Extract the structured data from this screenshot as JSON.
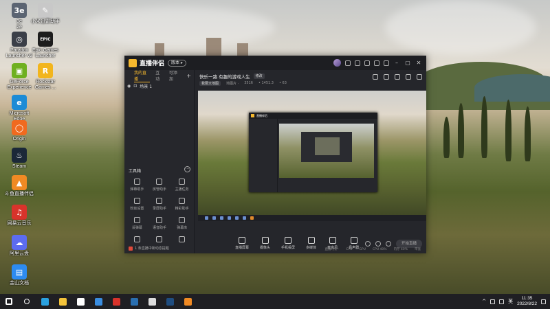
{
  "desktop": {
    "icons": [
      {
        "label": "3e\n2e",
        "color": "#5b6472",
        "glyph": "3e"
      },
      {
        "label": "小米迅雷助手",
        "color": "#c8c8c8",
        "glyph": "✎"
      },
      {
        "label": "Paradox\nLauncher v2",
        "color": "#3b3f48",
        "glyph": "◎"
      },
      {
        "label": "Epic Games\nLauncher",
        "color": "#1d1d1d",
        "glyph": "EPIC"
      },
      {
        "label": "GeForce\nExperience",
        "color": "#6fb020",
        "glyph": "▣"
      },
      {
        "label": "Rockstar\nGames ...",
        "color": "#f2b51d",
        "glyph": "R"
      },
      {
        "label": "Microsoft\nEdge",
        "color": "#1c8bd6",
        "glyph": "e"
      },
      {
        "label": "Origin",
        "color": "#f06a1f",
        "glyph": "◯"
      },
      {
        "label": "Steam",
        "color": "#1b2838",
        "glyph": "♨"
      },
      {
        "label": "斗鱼直播伴侣",
        "color": "#f08a24",
        "glyph": "▲"
      },
      {
        "label": "网易云音乐",
        "color": "#d8332b",
        "glyph": "♫"
      },
      {
        "label": "阿里云盘",
        "color": "#5c6cf0",
        "glyph": "☁"
      },
      {
        "label": "金山文档",
        "color": "#2d8bf0",
        "glyph": "▤"
      }
    ]
  },
  "app": {
    "name": "直播伴侣",
    "version_badge": "版本 ▸",
    "tabs": [
      "我的直播",
      "互动",
      "可添加"
    ],
    "add_label": "+",
    "scene_label": "场景 1",
    "toolbox_title": "工具箱",
    "toolbox_more": "···",
    "tools": [
      "弹幕助手",
      "房管助手",
      "主播任务",
      "粉丝设置",
      "录屏助手",
      "精彩助手",
      "设弹幕",
      "语音助手",
      "弹幕库",
      "",
      "",
      ""
    ],
    "footer_text": "1 条直播中新动态提醒",
    "stream_title": "快乐一路 有趣的游戏人生",
    "stream_edit": "修改",
    "stream_category": "我要大地图",
    "stream_meta": [
      "地图片 ·",
      "3516",
      "• 1451.3",
      "• 63"
    ],
    "bottom_tools": [
      "直播屏幕",
      "摄像头",
      "手机投屏",
      "多媒体",
      "麦克风",
      "扬声器"
    ],
    "go_live": "开始直播",
    "status_items": [
      "直播时长 ·",
      "CPU",
      "GPU",
      "CPU 40%",
      "内存 40%",
      "带宽"
    ]
  },
  "nested": {
    "name": "直播伴侣"
  },
  "taskbar": {
    "icons": [
      {
        "name": "start",
        "color": "#ffffff"
      },
      {
        "name": "search",
        "color": "#ffffff"
      },
      {
        "name": "edge",
        "color": "#2aa1e0"
      },
      {
        "name": "explorer",
        "color": "#f3c33a"
      },
      {
        "name": "store",
        "color": "#ffffff"
      },
      {
        "name": "mail",
        "color": "#3a8de0"
      },
      {
        "name": "netease",
        "color": "#d8332b"
      },
      {
        "name": "steam",
        "color": "#2a6fb0"
      },
      {
        "name": "epic",
        "color": "#dddddd"
      },
      {
        "name": "steam2",
        "color": "#1f4d80"
      },
      {
        "name": "douyu",
        "color": "#f08a24"
      }
    ],
    "ime": "英",
    "time": "11:35",
    "date": "2022/8/22"
  }
}
